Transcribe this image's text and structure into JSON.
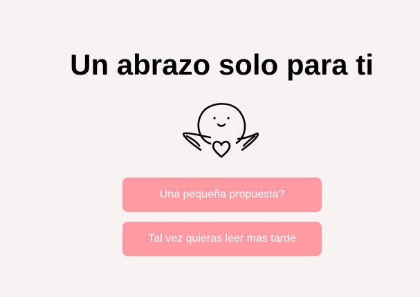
{
  "header": {
    "title": "Un abrazo solo para ti"
  },
  "illustration": {
    "icon": "hugging-character-with-heart-icon"
  },
  "actions": {
    "proposal_label": "Una pequeña propuesta?",
    "later_label": "Tal vez quieras leer mas tarde"
  },
  "colors": {
    "background": "#f9f2f3",
    "button": "#ff9aa3",
    "button_text": "#ffffff",
    "title": "#000000"
  }
}
